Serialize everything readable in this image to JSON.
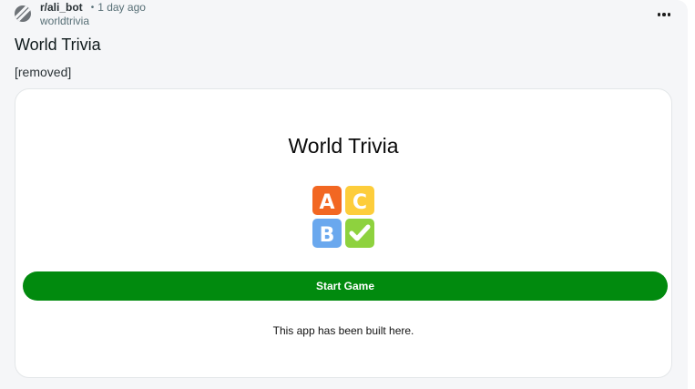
{
  "post": {
    "subreddit": "r/ali_bot",
    "separator": "•",
    "timestamp": "1 day ago",
    "author": "worldtrivia",
    "title": "World Trivia",
    "body": "[removed]",
    "more_icon": "ellipsis-icon",
    "avatar_icon": "subreddit-avatar-icon"
  },
  "app": {
    "title": "World Trivia",
    "logo": {
      "icon": "abc-quiz-logo-icon",
      "tiles": [
        {
          "letter": "A",
          "color": "#f26722"
        },
        {
          "letter": "C",
          "color": "#fdcd3b"
        },
        {
          "letter": "B",
          "color": "#6aa8ee"
        },
        {
          "letter": "✓",
          "color": "#8ed23e"
        }
      ]
    },
    "start_label": "Start Game",
    "start_color": "#018a0e",
    "footer_text": "This app has been built here."
  }
}
